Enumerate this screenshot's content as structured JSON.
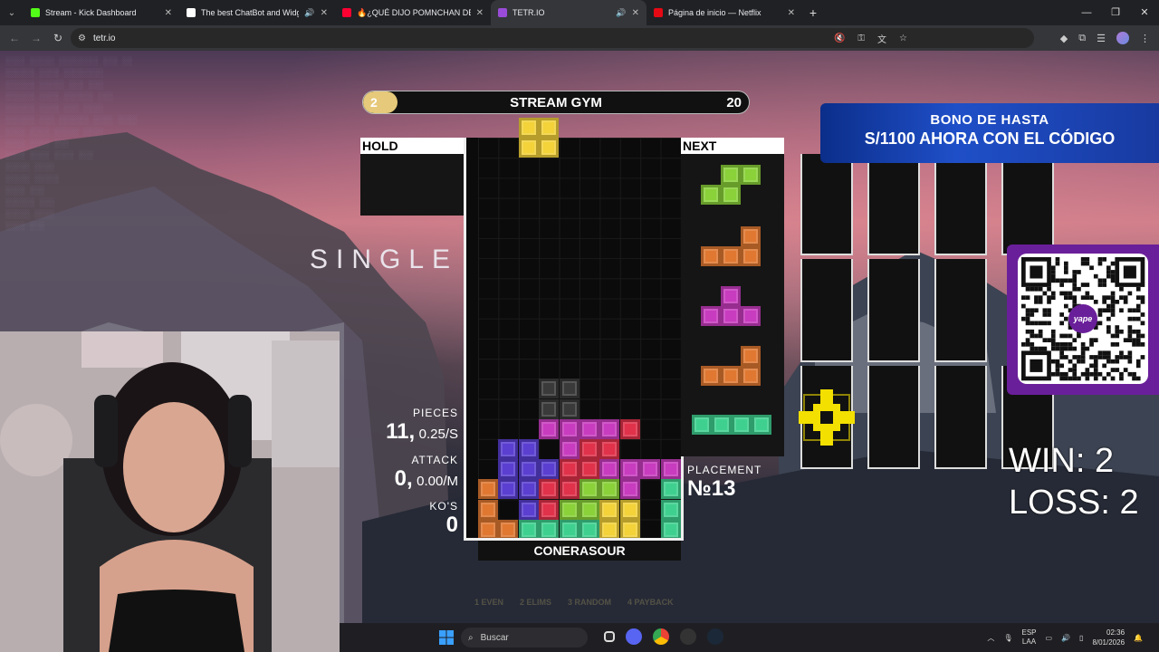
{
  "browser": {
    "tabs": [
      {
        "title": "Stream - Kick Dashboard",
        "favicon_color": "#53fc18",
        "active": false,
        "audio": false
      },
      {
        "title": "The best ChatBot and Widg",
        "favicon_color": "#ffffff",
        "active": false,
        "audio": true
      },
      {
        "title": "🔥¿QUÉ DIJO POMNCHAN DE",
        "favicon_color": "#ff0033",
        "active": false,
        "audio": false
      },
      {
        "title": "TETR.IO",
        "favicon_color": "#9a4cd8",
        "active": true,
        "audio": true
      },
      {
        "title": "Página de inicio — Netflix",
        "favicon_color": "#e50914",
        "active": false,
        "audio": false
      }
    ],
    "url": "tetr.io"
  },
  "game": {
    "mode_label": "SINGLE",
    "progress": {
      "level": "2",
      "title": "STREAM GYM",
      "goal": "20",
      "fill_fraction": 0.09
    },
    "hold_label": "HOLD",
    "next_label": "NEXT",
    "stats": {
      "pieces_label": "PIECES",
      "pieces_value": "11,",
      "pieces_rate": "0.25/S",
      "attack_label": "ATTACK",
      "attack_value": "0,",
      "attack_rate": "0.00/M",
      "kos_label": "KO'S",
      "kos_value": "0"
    },
    "placement_label": "PLACEMENT",
    "placement_value": "№13",
    "player_name": "CONERASOUR",
    "hotkeys": [
      "1 EVEN",
      "2 ELIMS",
      "3 RANDOM",
      "4 PAYBACK"
    ],
    "colors": {
      "O": "#f3d23a",
      "S": "#8ad13a",
      "L": "#e07832",
      "T": "#c83cbf",
      "I": "#3fd08f",
      "J": "#5a3fd0",
      "Z": "#e0324a",
      "garbage": "#3a3a3a"
    }
  },
  "overlay": {
    "bono_line1": "BONO DE HASTA",
    "bono_line2": "S/1100 AHORA CON EL CÓDIGO",
    "qr_brand": "yape",
    "win_label": "WIN: 2",
    "loss_label": "LOSS: 2"
  },
  "taskbar": {
    "search_placeholder": "Buscar",
    "lang": "ESP",
    "lang2": "LAA",
    "time": "02:36",
    "date": "8/01/2026"
  }
}
